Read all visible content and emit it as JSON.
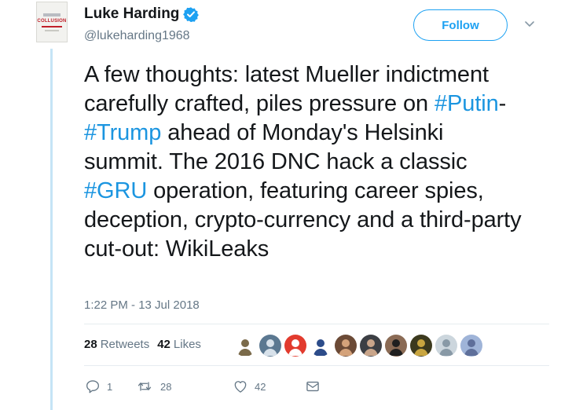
{
  "author": {
    "display_name": "Luke Harding",
    "handle": "@lukeharding1968",
    "avatar_text": "COLLUSION",
    "verified": true
  },
  "follow_label": "Follow",
  "tweet": {
    "text_parts": [
      {
        "text": "A few thoughts: latest Mueller indictment carefully crafted, piles pressure on ",
        "hashtag": false
      },
      {
        "text": "#Putin",
        "hashtag": true
      },
      {
        "text": "-",
        "hashtag": false
      },
      {
        "text": "#Trump",
        "hashtag": true
      },
      {
        "text": " ahead of Monday's Helsinki summit. The 2016 DNC hack a classic ",
        "hashtag": false
      },
      {
        "text": "#GRU",
        "hashtag": true
      },
      {
        "text": " operation, featuring career spies, deception, crypto-currency and a third-party cut-out: WikiLeaks",
        "hashtag": false
      }
    ],
    "timestamp": "1:22 PM - 13 Jul 2018"
  },
  "stats": {
    "retweets_count": "28",
    "retweets_label": "Retweets",
    "likes_count": "42",
    "likes_label": "Likes"
  },
  "actions": {
    "reply_count": "1",
    "retweet_count": "28",
    "like_count": "42"
  },
  "colors": {
    "accent": "#1da1f2",
    "hashtag": "#1b95e0",
    "muted": "#657786",
    "thread_line": "#c5e4f6"
  },
  "liker_avatars": [
    {
      "icon": "statue-avatar",
      "bg": "#ffffff",
      "fg": "#7a6a4a"
    },
    {
      "icon": "jet-avatar",
      "bg": "#5b7891",
      "fg": "#d7e1ea"
    },
    {
      "icon": "red-face-avatar",
      "bg": "#e23b2e",
      "fg": "#ffffff"
    },
    {
      "icon": "crest-avatar",
      "bg": "#ffffff",
      "fg": "#2c4c8a"
    },
    {
      "icon": "portrait-avatar",
      "bg": "#6b4a36",
      "fg": "#d4a27a"
    },
    {
      "icon": "person-avatar",
      "bg": "#3c3f44",
      "fg": "#c9a58a"
    },
    {
      "icon": "man-avatar",
      "bg": "#8b6b55",
      "fg": "#1f1f1f"
    },
    {
      "icon": "emblem-avatar",
      "bg": "#3c3a1e",
      "fg": "#c9a640"
    },
    {
      "icon": "default-avatar",
      "bg": "#ccd6dd",
      "fg": "#8899a6"
    },
    {
      "icon": "drawing-avatar",
      "bg": "#9fb4d8",
      "fg": "#5e6f9a"
    }
  ]
}
